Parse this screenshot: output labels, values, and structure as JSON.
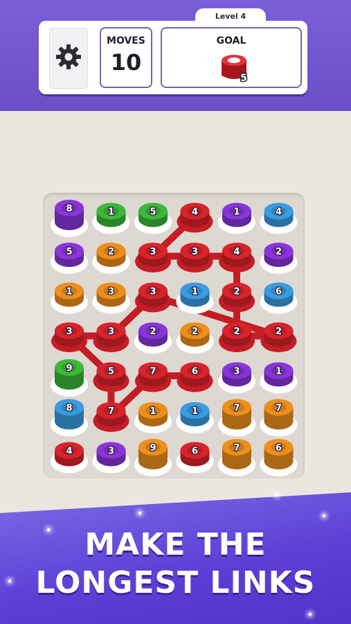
{
  "header": {
    "level_label": "Level 4",
    "moves_label": "MOVES",
    "moves_value": "10",
    "goal_label": "GOAL",
    "goal_color": "#d6242b",
    "goal_count": "5"
  },
  "icons": {
    "settings": "gear-icon",
    "goal": "red-ring-token-icon"
  },
  "colors": {
    "purple": "#8a35d8",
    "green": "#3cb83a",
    "blue": "#3a9be0",
    "orange": "#ee8f1c",
    "red": "#d9232b",
    "link": "#c41d25"
  },
  "board": {
    "rows": 7,
    "cols": 6,
    "cells": [
      [
        {
          "c": "purple",
          "n": "8",
          "h": "tall"
        },
        {
          "c": "green",
          "n": "1"
        },
        {
          "c": "green",
          "n": "5"
        },
        {
          "c": "red",
          "n": "4",
          "s": true
        },
        {
          "c": "purple",
          "n": "1"
        },
        {
          "c": "blue",
          "n": "4"
        }
      ],
      [
        {
          "c": "purple",
          "n": "5"
        },
        {
          "c": "orange",
          "n": "2"
        },
        {
          "c": "red",
          "n": "3",
          "s": true
        },
        {
          "c": "red",
          "n": "3",
          "s": true
        },
        {
          "c": "red",
          "n": "4",
          "s": true
        },
        {
          "c": "purple",
          "n": "2"
        }
      ],
      [
        {
          "c": "orange",
          "n": "1"
        },
        {
          "c": "orange",
          "n": "3"
        },
        {
          "c": "red",
          "n": "3",
          "s": true
        },
        {
          "c": "blue",
          "n": "1"
        },
        {
          "c": "red",
          "n": "2",
          "s": true
        },
        {
          "c": "blue",
          "n": "6"
        }
      ],
      [
        {
          "c": "red",
          "n": "3",
          "s": true
        },
        {
          "c": "red",
          "n": "3",
          "s": true
        },
        {
          "c": "purple",
          "n": "2"
        },
        {
          "c": "orange",
          "n": "2"
        },
        {
          "c": "red",
          "n": "2",
          "s": true
        },
        {
          "c": "red",
          "n": "2",
          "s": true
        }
      ],
      [
        {
          "c": "green",
          "n": "9",
          "h": "tall"
        },
        {
          "c": "red",
          "n": "5",
          "s": true
        },
        {
          "c": "red",
          "n": "7",
          "s": true
        },
        {
          "c": "red",
          "n": "6",
          "s": true
        },
        {
          "c": "purple",
          "n": "3"
        },
        {
          "c": "purple",
          "n": "1"
        }
      ],
      [
        {
          "c": "blue",
          "n": "8",
          "h": "tall"
        },
        {
          "c": "red",
          "n": "7",
          "s": true
        },
        {
          "c": "orange",
          "n": "1"
        },
        {
          "c": "blue",
          "n": "1"
        },
        {
          "c": "orange",
          "n": "7",
          "h": "tall"
        },
        {
          "c": "orange",
          "n": "7",
          "h": "tall"
        }
      ],
      [
        {
          "c": "red",
          "n": "4"
        },
        {
          "c": "purple",
          "n": "3"
        },
        {
          "c": "orange",
          "n": "9",
          "h": "tall"
        },
        {
          "c": "red",
          "n": "6"
        },
        {
          "c": "orange",
          "n": "7",
          "h": "tall"
        },
        {
          "c": "orange",
          "n": "6",
          "h": "tall"
        }
      ]
    ],
    "link_path": [
      [
        0,
        3
      ],
      [
        1,
        2
      ],
      [
        1,
        3
      ],
      [
        1,
        4
      ],
      [
        2,
        4
      ],
      [
        3,
        4
      ],
      [
        3,
        5
      ],
      [
        2,
        2
      ],
      [
        3,
        1
      ],
      [
        3,
        0
      ],
      [
        4,
        1
      ],
      [
        5,
        1
      ],
      [
        4,
        2
      ],
      [
        4,
        3
      ]
    ]
  },
  "tagline": {
    "line1": "MAKE THE",
    "line2": "LONGEST LINKS"
  }
}
